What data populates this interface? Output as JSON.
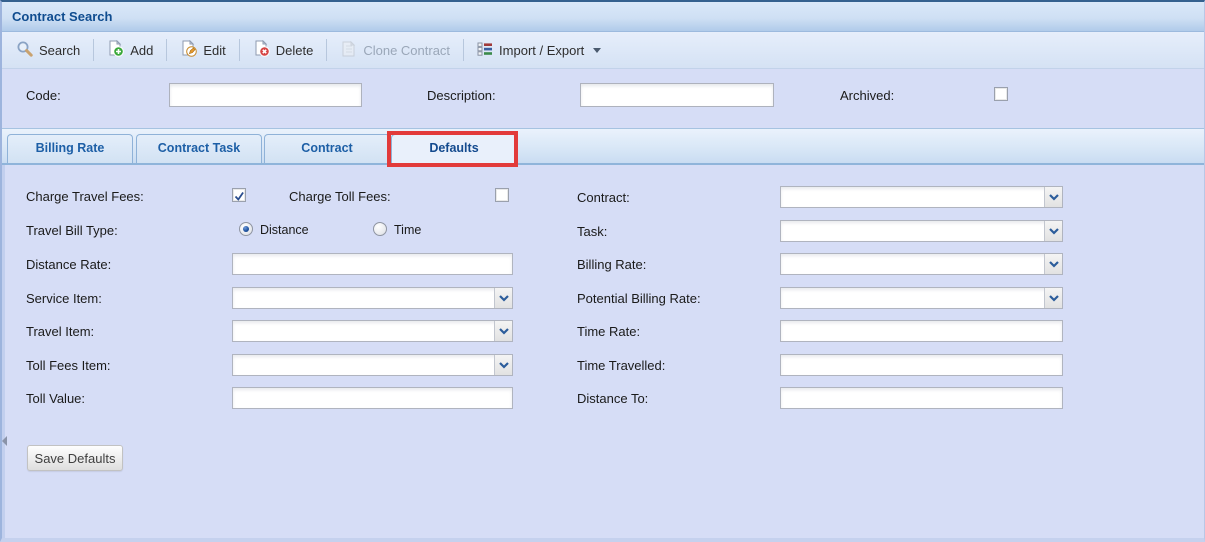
{
  "window": {
    "title": "Contract Search"
  },
  "toolbar": {
    "buttons": [
      {
        "label": "Search",
        "icon": "search-icon",
        "disabled": false
      },
      {
        "label": "Add",
        "icon": "add-icon",
        "disabled": false
      },
      {
        "label": "Edit",
        "icon": "edit-icon",
        "disabled": false
      },
      {
        "label": "Delete",
        "icon": "delete-icon",
        "disabled": false
      },
      {
        "label": "Clone Contract",
        "icon": "clone-contract-icon",
        "disabled": true
      },
      {
        "label": "Import / Export",
        "icon": "import-export-icon",
        "disabled": false,
        "has_dropdown": true
      }
    ]
  },
  "search_row": {
    "code_label": "Code:",
    "code_value": "",
    "description_label": "Description:",
    "description_value": "",
    "archived_label": "Archived:",
    "archived_checked": false
  },
  "tabs": [
    {
      "label": "Billing Rate",
      "active": false
    },
    {
      "label": "Contract Task",
      "active": false
    },
    {
      "label": "Contract",
      "active": false
    },
    {
      "label": "Defaults",
      "active": true
    }
  ],
  "annotation": {
    "type": "red-highlight-box",
    "target": "Defaults tab",
    "color": "#e23a3a"
  },
  "defaults_form": {
    "charge_travel_fees": {
      "label": "Charge Travel Fees:",
      "checked": true
    },
    "charge_toll_fees": {
      "label": "Charge Toll Fees:",
      "checked": false
    },
    "travel_bill_type": {
      "label": "Travel Bill Type:",
      "options": [
        {
          "label": "Distance",
          "selected": true
        },
        {
          "label": "Time",
          "selected": false
        }
      ]
    },
    "distance_rate": {
      "label": "Distance Rate:",
      "value": ""
    },
    "service_item": {
      "label": "Service Item:",
      "value": ""
    },
    "travel_item": {
      "label": "Travel Item:",
      "value": ""
    },
    "toll_fees_item": {
      "label": "Toll Fees Item:",
      "value": ""
    },
    "toll_value": {
      "label": "Toll Value:",
      "value": ""
    },
    "contract": {
      "label": "Contract:",
      "value": ""
    },
    "task": {
      "label": "Task:",
      "value": ""
    },
    "billing_rate": {
      "label": "Billing Rate:",
      "value": ""
    },
    "potential_billing_rate": {
      "label": "Potential Billing Rate:",
      "value": ""
    },
    "time_rate": {
      "label": "Time Rate:",
      "value": ""
    },
    "time_travelled": {
      "label": "Time Travelled:",
      "value": ""
    },
    "distance_to": {
      "label": "Distance To:",
      "value": ""
    },
    "save_button_label": "Save Defaults"
  }
}
